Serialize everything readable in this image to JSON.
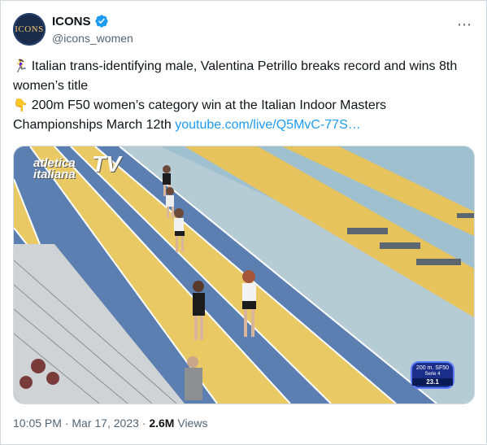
{
  "tweet": {
    "display_name": "ICONS",
    "handle": "@icons_women",
    "avatar_text": "ICONS",
    "line1_emoji": "🏃‍♀️",
    "line1": "Italian trans-identifying male, Valentina Petrillo breaks record and wins 8th women’s title",
    "line2_emoji": "👇",
    "line2": "200m F50 women’s category win at the Italian Indoor Masters Championships March 12th ",
    "link": "youtube.com/live/Q5MvC-77S…",
    "time": "10:05 PM",
    "dot": "·",
    "date": "Mar 17, 2023",
    "views_count": "2.6M",
    "views_label": "Views"
  },
  "media": {
    "logo_line1": "atletica",
    "logo_line2": "italiana",
    "logo_tv": "TV",
    "badge_line1": "200 m. SF50",
    "badge_line2": "Serie 4",
    "badge_time": "23.1"
  },
  "icons": {
    "verified": "verified-check-icon",
    "more": "more-dots-icon"
  },
  "colors": {
    "link": "#1d9bf0",
    "secondary": "#536471",
    "verified": "#1d9bf0"
  }
}
